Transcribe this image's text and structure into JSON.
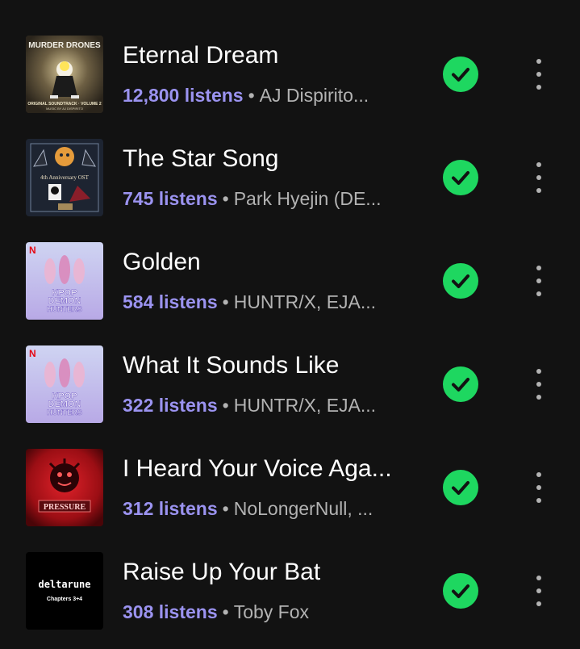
{
  "colors": {
    "background": "#121212",
    "listens_accent": "#9b93f0",
    "check_green": "#1ed760",
    "secondary_text": "#b3b3b3"
  },
  "tracks": [
    {
      "title": "Eternal Dream",
      "listens": "12,800 listens",
      "separator": "•",
      "artist": "AJ Dispirito...",
      "art": {
        "title": "MURDER DRONES",
        "subtitle": "ORIGINAL SOUNDTRACK · VOLUME 2",
        "credit": "MUSIC BY AJ DISPIRITO"
      }
    },
    {
      "title": "The Star Song",
      "listens": "745 listens",
      "separator": "•",
      "artist": "Park Hyejin (DE...",
      "art": {
        "title": "4th Anniversary OST"
      }
    },
    {
      "title": "Golden",
      "listens": "584 listens",
      "separator": "•",
      "artist": "HUNTR/X, EJA...",
      "art": {
        "badge": "N",
        "line1": "KPOP",
        "line2": "DEMON",
        "line3": "HUNTERS"
      }
    },
    {
      "title": "What It Sounds Like",
      "listens": "322 listens",
      "separator": "•",
      "artist": "HUNTR/X, EJA...",
      "art": {
        "badge": "N",
        "line1": "KPOP",
        "line2": "DEMON",
        "line3": "HUNTERS"
      }
    },
    {
      "title": "I Heard Your Voice Aga...",
      "listens": "312 listens",
      "separator": "•",
      "artist": "NoLongerNull, ...",
      "art": {
        "title": "PRESSURE"
      }
    },
    {
      "title": "Raise Up Your Bat",
      "listens": "308 listens",
      "separator": "•",
      "artist": "Toby Fox",
      "art": {
        "title": "deltarune",
        "subtitle": "Chapters 3+4"
      }
    }
  ]
}
